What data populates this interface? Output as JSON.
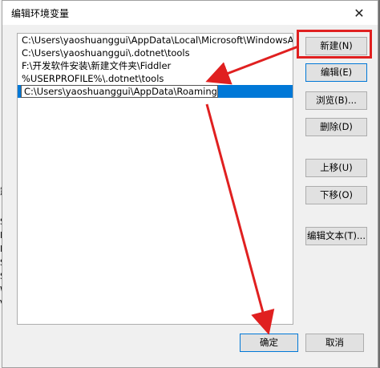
{
  "window": {
    "title": "编辑环境变量",
    "close_glyph": "✕"
  },
  "paths": [
    "C:\\Users\\yaoshuanggui\\AppData\\Local\\Microsoft\\WindowsApps",
    "C:\\Users\\yaoshuanggui\\.dotnet\\tools",
    "F:\\开发软件安装\\新建文件夹\\Fiddler",
    "%USERPROFILE%\\.dotnet\\tools"
  ],
  "editing_value": "C:\\Users\\yaoshuanggui\\AppData\\Roaming\\npm",
  "buttons": {
    "new": "新建(N)",
    "edit": "编辑(E)",
    "browse": "浏览(B)...",
    "delete": "删除(D)",
    "move_up": "上移(U)",
    "move_down": "下移(O)",
    "edit_text": "编辑文本(T)...",
    "ok": "确定",
    "cancel": "取消"
  },
  "background_letters": [
    "露",
    "S",
    "E",
    "M",
    "S",
    "S",
    "W",
    "V"
  ],
  "colors": {
    "annotation": "#e02020",
    "selection": "#0078d7"
  }
}
